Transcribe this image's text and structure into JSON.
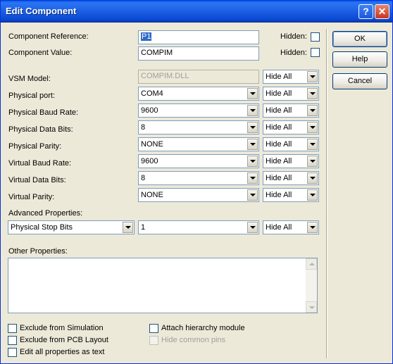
{
  "window": {
    "title": "Edit Component"
  },
  "component": {
    "reference_label": "Component Reference:",
    "reference_value": "P1",
    "value_label": "Component Value:",
    "value_value": "COMPIM",
    "hidden_label": "Hidden:"
  },
  "buttons": {
    "ok": "OK",
    "help": "Help",
    "cancel": "Cancel"
  },
  "properties": [
    {
      "label": "VSM Model:",
      "value": "COMPIM.DLL",
      "vis": "Hide All"
    },
    {
      "label": "Physical port:",
      "value": "COM4",
      "vis": "Hide All"
    },
    {
      "label": "Physical Baud Rate:",
      "value": "9600",
      "vis": "Hide All"
    },
    {
      "label": "Physical Data Bits:",
      "value": "8",
      "vis": "Hide All"
    },
    {
      "label": "Physical Parity:",
      "value": "NONE",
      "vis": "Hide All"
    },
    {
      "label": "Virtual Baud Rate:",
      "value": "9600",
      "vis": "Hide All"
    },
    {
      "label": "Virtual Data Bits:",
      "value": "8",
      "vis": "Hide All"
    },
    {
      "label": "Virtual Parity:",
      "value": "NONE",
      "vis": "Hide All"
    }
  ],
  "advanced": {
    "label": "Advanced Properties:",
    "property": "Physical Stop Bits",
    "value": "1",
    "vis": "Hide All"
  },
  "other": {
    "label": "Other Properties:"
  },
  "checkboxes": {
    "exclude_sim": "Exclude from Simulation",
    "exclude_pcb": "Exclude from PCB Layout",
    "edit_all": "Edit all properties as text",
    "attach_hier": "Attach hierarchy module",
    "hide_pins": "Hide common pins"
  }
}
